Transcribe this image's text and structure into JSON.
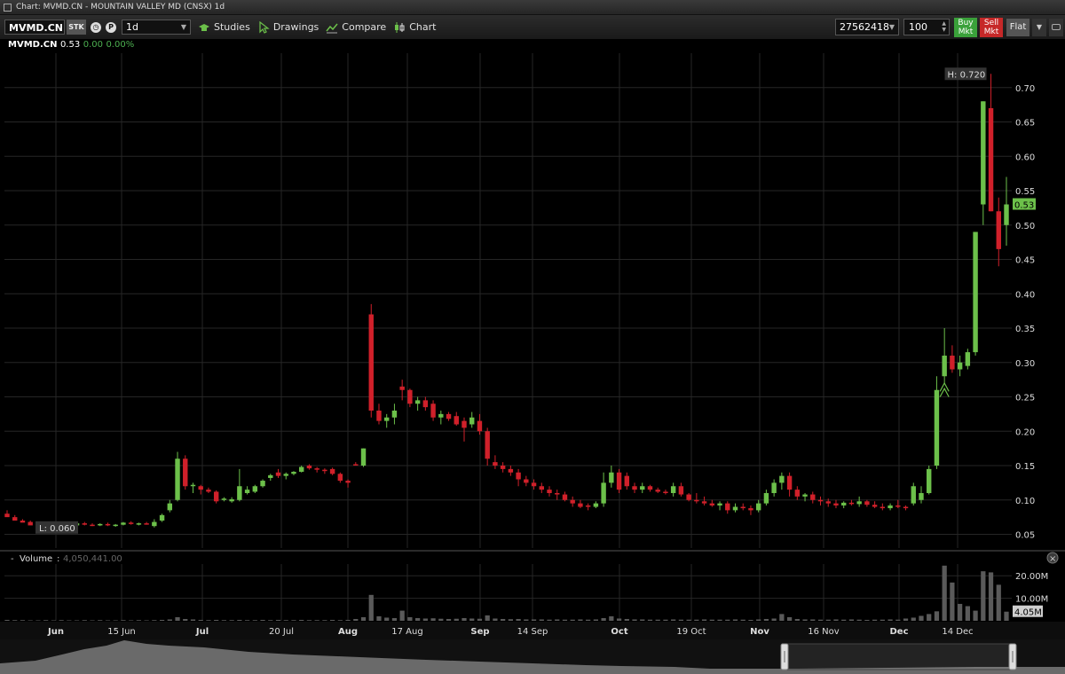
{
  "window": {
    "title": "Chart: MVMD.CN - MOUNTAIN VALLEY MD (CNSX) 1d"
  },
  "toolbar": {
    "symbol": "MVMD.CN",
    "sec_type": "STK",
    "period": "1d",
    "studies_label": "Studies",
    "drawings_label": "Drawings",
    "compare_label": "Compare",
    "chart_label": "Chart",
    "account": "27562418",
    "quantity": "100",
    "buy_line1": "Buy",
    "buy_line2": "Mkt",
    "sell_line1": "Sell",
    "sell_line2": "Mkt",
    "flat_label": "Flat"
  },
  "quote": {
    "symbol": "MVMD.CN",
    "last": "0.53",
    "change": "0.00",
    "change_pct": "0.00%"
  },
  "colors": {
    "up": "#6cc04a",
    "down": "#d0202a",
    "background": "#000000",
    "grid": "#262626",
    "volume": "#5a5a5a"
  },
  "chart_data": {
    "type": "candlestick",
    "y_range": [
      0.03,
      0.75
    ],
    "price_ticks": [
      "0.70",
      "0.65",
      "0.60",
      "0.55",
      "0.50",
      "0.45",
      "0.40",
      "0.35",
      "0.30",
      "0.25",
      "0.20",
      "0.15",
      "0.10",
      "0.05"
    ],
    "x_labels": [
      "Jun",
      "15 Jun",
      "Jul",
      "20 Jul",
      "Aug",
      "17 Aug",
      "Sep",
      "14 Sep",
      "Oct",
      "19 Oct",
      "Nov",
      "16 Nov",
      "Dec",
      "14 Dec"
    ],
    "high_label": "H: 0.720",
    "low_label": "L: 0.060",
    "last_badge": "0.53",
    "volume_label": "Volume",
    "volume_value": "4,050,441.00",
    "volume_ticks": [
      "20.00M",
      "10.00M"
    ],
    "volume_badge": "4.05M",
    "candles": [
      [
        0.08,
        0.085,
        0.078,
        0.075
      ],
      [
        0.075,
        0.078,
        0.072,
        0.07
      ],
      [
        0.07,
        0.072,
        0.068,
        0.067
      ],
      [
        0.068,
        0.07,
        0.064,
        0.063
      ],
      [
        0.065,
        0.067,
        0.062,
        0.06
      ],
      [
        0.062,
        0.065,
        0.061,
        0.063
      ],
      [
        0.063,
        0.065,
        0.061,
        0.062
      ],
      [
        0.062,
        0.066,
        0.061,
        0.064
      ],
      [
        0.064,
        0.066,
        0.062,
        0.063
      ],
      [
        0.063,
        0.067,
        0.062,
        0.066
      ],
      [
        0.066,
        0.068,
        0.063,
        0.064
      ],
      [
        0.064,
        0.066,
        0.062,
        0.063
      ],
      [
        0.063,
        0.066,
        0.062,
        0.065
      ],
      [
        0.065,
        0.067,
        0.062,
        0.063
      ],
      [
        0.063,
        0.065,
        0.061,
        0.064
      ],
      [
        0.064,
        0.068,
        0.063,
        0.067
      ],
      [
        0.067,
        0.069,
        0.064,
        0.065
      ],
      [
        0.065,
        0.067,
        0.063,
        0.066
      ],
      [
        0.066,
        0.068,
        0.064,
        0.065
      ],
      [
        0.062,
        0.072,
        0.06,
        0.068
      ],
      [
        0.07,
        0.08,
        0.068,
        0.078
      ],
      [
        0.085,
        0.1,
        0.082,
        0.095
      ],
      [
        0.1,
        0.17,
        0.098,
        0.16
      ],
      [
        0.16,
        0.165,
        0.115,
        0.12
      ],
      [
        0.12,
        0.125,
        0.11,
        0.122
      ],
      [
        0.12,
        0.122,
        0.108,
        0.115
      ],
      [
        0.115,
        0.118,
        0.11,
        0.112
      ],
      [
        0.112,
        0.114,
        0.095,
        0.098
      ],
      [
        0.1,
        0.104,
        0.098,
        0.102
      ],
      [
        0.098,
        0.104,
        0.096,
        0.101
      ],
      [
        0.1,
        0.145,
        0.098,
        0.12
      ],
      [
        0.11,
        0.12,
        0.108,
        0.115
      ],
      [
        0.112,
        0.122,
        0.11,
        0.12
      ],
      [
        0.12,
        0.13,
        0.118,
        0.128
      ],
      [
        0.132,
        0.138,
        0.128,
        0.136
      ],
      [
        0.14,
        0.145,
        0.132,
        0.135
      ],
      [
        0.135,
        0.14,
        0.13,
        0.138
      ],
      [
        0.138,
        0.142,
        0.136,
        0.141
      ],
      [
        0.141,
        0.15,
        0.14,
        0.148
      ],
      [
        0.15,
        0.152,
        0.144,
        0.146
      ],
      [
        0.146,
        0.148,
        0.14,
        0.144
      ],
      [
        0.144,
        0.146,
        0.138,
        0.142
      ],
      [
        0.145,
        0.147,
        0.136,
        0.138
      ],
      [
        0.138,
        0.14,
        0.125,
        0.128
      ],
      [
        0.128,
        0.13,
        0.118,
        0.125
      ],
      [
        0.152,
        0.155,
        0.15,
        0.151
      ],
      [
        0.15,
        0.175,
        0.148,
        0.175
      ],
      [
        0.37,
        0.385,
        0.22,
        0.23
      ],
      [
        0.23,
        0.24,
        0.21,
        0.215
      ],
      [
        0.215,
        0.225,
        0.205,
        0.22
      ],
      [
        0.22,
        0.24,
        0.21,
        0.23
      ],
      [
        0.265,
        0.275,
        0.245,
        0.26
      ],
      [
        0.26,
        0.262,
        0.235,
        0.24
      ],
      [
        0.24,
        0.25,
        0.23,
        0.245
      ],
      [
        0.245,
        0.25,
        0.23,
        0.235
      ],
      [
        0.24,
        0.245,
        0.215,
        0.22
      ],
      [
        0.22,
        0.23,
        0.21,
        0.225
      ],
      [
        0.225,
        0.228,
        0.215,
        0.218
      ],
      [
        0.222,
        0.228,
        0.208,
        0.21
      ],
      [
        0.215,
        0.22,
        0.185,
        0.205
      ],
      [
        0.21,
        0.228,
        0.205,
        0.22
      ],
      [
        0.215,
        0.225,
        0.195,
        0.2
      ],
      [
        0.2,
        0.205,
        0.15,
        0.16
      ],
      [
        0.155,
        0.165,
        0.145,
        0.15
      ],
      [
        0.15,
        0.155,
        0.14,
        0.145
      ],
      [
        0.145,
        0.15,
        0.135,
        0.14
      ],
      [
        0.14,
        0.145,
        0.12,
        0.13
      ],
      [
        0.13,
        0.135,
        0.12,
        0.125
      ],
      [
        0.125,
        0.13,
        0.115,
        0.12
      ],
      [
        0.12,
        0.125,
        0.11,
        0.115
      ],
      [
        0.115,
        0.12,
        0.105,
        0.11
      ],
      [
        0.11,
        0.115,
        0.1,
        0.108
      ],
      [
        0.108,
        0.112,
        0.098,
        0.1
      ],
      [
        0.1,
        0.105,
        0.09,
        0.095
      ],
      [
        0.095,
        0.1,
        0.088,
        0.09
      ],
      [
        0.092,
        0.095,
        0.085,
        0.09
      ],
      [
        0.09,
        0.098,
        0.088,
        0.095
      ],
      [
        0.095,
        0.14,
        0.09,
        0.125
      ],
      [
        0.125,
        0.15,
        0.118,
        0.14
      ],
      [
        0.14,
        0.145,
        0.11,
        0.115
      ],
      [
        0.135,
        0.14,
        0.115,
        0.12
      ],
      [
        0.12,
        0.125,
        0.11,
        0.115
      ],
      [
        0.115,
        0.125,
        0.11,
        0.12
      ],
      [
        0.12,
        0.122,
        0.112,
        0.115
      ],
      [
        0.115,
        0.118,
        0.11,
        0.112
      ],
      [
        0.112,
        0.115,
        0.108,
        0.11
      ],
      [
        0.11,
        0.125,
        0.105,
        0.12
      ],
      [
        0.12,
        0.125,
        0.105,
        0.108
      ],
      [
        0.108,
        0.11,
        0.098,
        0.1
      ],
      [
        0.1,
        0.11,
        0.095,
        0.098
      ],
      [
        0.098,
        0.105,
        0.092,
        0.095
      ],
      [
        0.095,
        0.1,
        0.09,
        0.092
      ],
      [
        0.092,
        0.098,
        0.085,
        0.095
      ],
      [
        0.095,
        0.098,
        0.08,
        0.085
      ],
      [
        0.085,
        0.095,
        0.082,
        0.09
      ],
      [
        0.09,
        0.095,
        0.085,
        0.088
      ],
      [
        0.088,
        0.092,
        0.078,
        0.085
      ],
      [
        0.085,
        0.1,
        0.082,
        0.095
      ],
      [
        0.095,
        0.115,
        0.092,
        0.11
      ],
      [
        0.11,
        0.13,
        0.105,
        0.125
      ],
      [
        0.125,
        0.14,
        0.115,
        0.135
      ],
      [
        0.135,
        0.14,
        0.105,
        0.115
      ],
      [
        0.115,
        0.12,
        0.1,
        0.105
      ],
      [
        0.105,
        0.11,
        0.098,
        0.108
      ],
      [
        0.108,
        0.112,
        0.095,
        0.1
      ],
      [
        0.1,
        0.105,
        0.092,
        0.098
      ],
      [
        0.098,
        0.102,
        0.09,
        0.095
      ],
      [
        0.095,
        0.1,
        0.088,
        0.092
      ],
      [
        0.092,
        0.098,
        0.088,
        0.096
      ],
      [
        0.096,
        0.1,
        0.092,
        0.094
      ],
      [
        0.094,
        0.105,
        0.09,
        0.098
      ],
      [
        0.098,
        0.1,
        0.09,
        0.093
      ],
      [
        0.093,
        0.098,
        0.088,
        0.09
      ],
      [
        0.09,
        0.095,
        0.085,
        0.088
      ],
      [
        0.088,
        0.095,
        0.085,
        0.092
      ],
      [
        0.092,
        0.1,
        0.088,
        0.09
      ],
      [
        0.09,
        0.092,
        0.085,
        0.088
      ],
      [
        0.095,
        0.125,
        0.092,
        0.12
      ],
      [
        0.1,
        0.12,
        0.095,
        0.11
      ],
      [
        0.11,
        0.15,
        0.108,
        0.145
      ],
      [
        0.15,
        0.28,
        0.145,
        0.26
      ],
      [
        0.28,
        0.35,
        0.27,
        0.31
      ],
      [
        0.31,
        0.325,
        0.285,
        0.29
      ],
      [
        0.29,
        0.31,
        0.28,
        0.3
      ],
      [
        0.295,
        0.32,
        0.29,
        0.315
      ],
      [
        0.315,
        0.49,
        0.31,
        0.49
      ],
      [
        0.53,
        0.68,
        0.5,
        0.68
      ],
      [
        0.67,
        0.72,
        0.52,
        0.52
      ],
      [
        0.52,
        0.54,
        0.44,
        0.465
      ],
      [
        0.5,
        0.57,
        0.47,
        0.53
      ]
    ],
    "volumes": [
      0.4,
      0.3,
      0.3,
      0.2,
      0.2,
      0.3,
      0.2,
      0.3,
      0.2,
      0.2,
      0.3,
      0.2,
      0.3,
      0.2,
      0.2,
      0.3,
      0.2,
      0.3,
      0.2,
      0.3,
      0.4,
      0.6,
      1.6,
      0.8,
      0.6,
      0.4,
      0.3,
      0.4,
      0.3,
      0.3,
      0.4,
      0.3,
      0.3,
      0.4,
      0.3,
      0.4,
      0.3,
      0.3,
      0.4,
      0.3,
      0.3,
      0.3,
      0.4,
      0.3,
      0.4,
      0.8,
      1.6,
      11.5,
      2.0,
      1.4,
      1.2,
      4.5,
      1.6,
      1.2,
      1.0,
      1.1,
      0.9,
      0.8,
      0.9,
      1.2,
      1.0,
      0.9,
      2.4,
      1.0,
      0.8,
      0.7,
      0.8,
      0.6,
      0.6,
      0.6,
      0.5,
      0.6,
      0.5,
      0.5,
      0.6,
      0.5,
      0.6,
      1.2,
      2.0,
      1.0,
      0.8,
      0.6,
      0.6,
      0.5,
      0.5,
      0.5,
      0.6,
      0.5,
      0.5,
      0.5,
      0.6,
      0.5,
      0.5,
      0.5,
      0.6,
      0.5,
      0.4,
      0.6,
      0.8,
      1.0,
      3.0,
      1.6,
      0.8,
      0.6,
      0.6,
      0.5,
      0.5,
      0.6,
      0.5,
      0.6,
      0.5,
      0.4,
      0.5,
      0.5,
      0.6,
      0.5,
      1.0,
      1.4,
      2.2,
      3.0,
      4.2,
      24.5,
      17.0,
      7.5,
      6.5,
      4.5,
      22.0,
      21.5,
      16.0,
      4.05
    ]
  }
}
